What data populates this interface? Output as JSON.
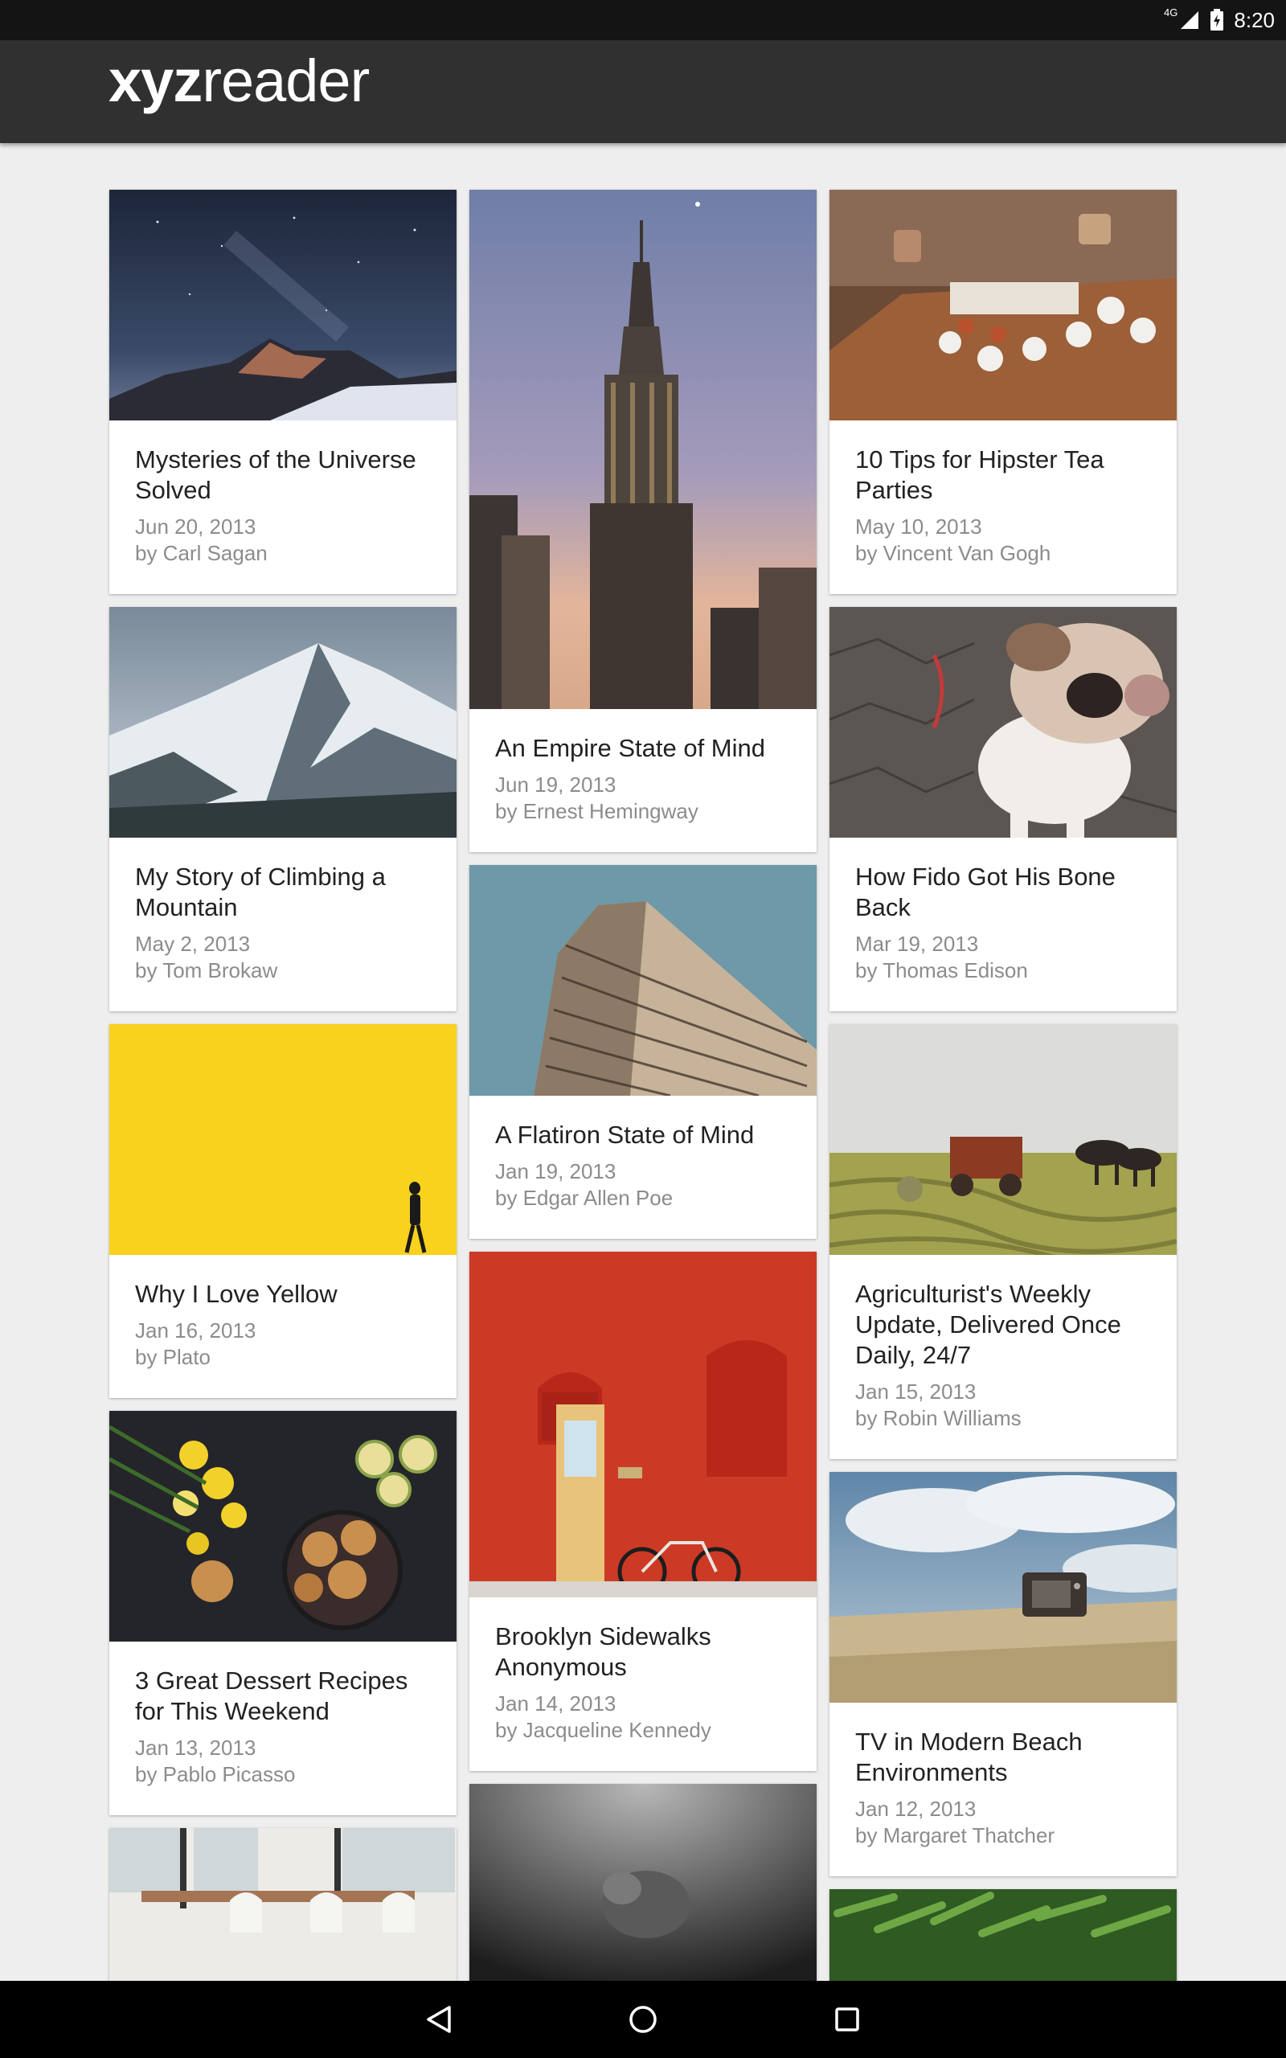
{
  "status_bar": {
    "network": "4G",
    "time": "8:20",
    "icons": [
      "signal-icon",
      "battery-charging-icon"
    ]
  },
  "app_bar": {
    "logo_bold": "xyz",
    "logo_rest": "reader"
  },
  "columns": [
    {
      "cards": [
        {
          "title": "Mysteries of the Universe Solved",
          "date": "Jun 20, 2013",
          "author": "by Carl Sagan",
          "image": "night-sky-mountains"
        },
        {
          "title": "My Story of Climbing a Mountain",
          "date": "May 2, 2013",
          "author": "by Tom Brokaw",
          "image": "snowy-mountain"
        },
        {
          "title": "Why I Love Yellow",
          "date": "Jan 16, 2013",
          "author": "by Plato",
          "image": "yellow-wall-person"
        },
        {
          "title": "3 Great Dessert Recipes for This Weekend",
          "date": "Jan 13, 2013",
          "author": "by Pablo Picasso",
          "image": "cookies-flowers-lemons"
        },
        {
          "title": "",
          "date": "",
          "author": "",
          "image": "dining-room-chairs"
        }
      ]
    },
    {
      "cards": [
        {
          "title": "An Empire State of Mind",
          "date": "Jun 19, 2013",
          "author": "by Ernest Hemingway",
          "image": "empire-state-building"
        },
        {
          "title": "A Flatiron State of Mind",
          "date": "Jan 19, 2013",
          "author": "by Edgar Allen Poe",
          "image": "flatiron-building"
        },
        {
          "title": "Brooklyn Sidewalks Anonymous",
          "date": "Jan 14, 2013",
          "author": "by Jacqueline Kennedy",
          "image": "red-brick-wall-bicycle"
        },
        {
          "title": "",
          "date": "",
          "author": "",
          "image": "underwater-swimmer"
        }
      ]
    },
    {
      "cards": [
        {
          "title": "10 Tips for Hipster Tea Parties",
          "date": "May 10, 2013",
          "author": "by Vincent Van Gogh",
          "image": "tea-cups-table"
        },
        {
          "title": "How Fido Got His Bone Back",
          "date": "Mar 19, 2013",
          "author": "by Thomas Edison",
          "image": "bulldog"
        },
        {
          "title": "Agriculturist's Weekly Update, Delivered Once Daily, 24/7",
          "date": "Jan 15, 2013",
          "author": "by Robin Williams",
          "image": "horse-drawn-farm-machine"
        },
        {
          "title": "TV in Modern Beach Environments",
          "date": "Jan 12, 2013",
          "author": "by Margaret Thatcher",
          "image": "tv-on-beach"
        },
        {
          "title": "",
          "date": "",
          "author": "",
          "image": "green-beans"
        }
      ]
    }
  ],
  "nav_bar": {
    "buttons": [
      "back-icon",
      "home-icon",
      "recents-icon"
    ]
  },
  "colors": {
    "status_bar": "#141414",
    "app_bar": "#303030",
    "background": "#eeeeee",
    "card": "#ffffff",
    "title_text": "#222222",
    "meta_text": "#8c8c8c"
  }
}
